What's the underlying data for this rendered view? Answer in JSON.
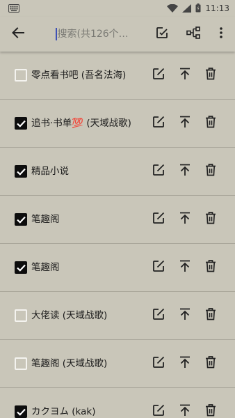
{
  "status_bar": {
    "time": "11:13",
    "icons": [
      "keyboard-icon",
      "wifi-icon",
      "signal-icon",
      "battery-icon"
    ]
  },
  "app_bar": {
    "icons": [
      "back-arrow-icon",
      "check-edit-icon",
      "tree-structure-icon",
      "more-vert-icon"
    ],
    "search": {
      "placeholder": "搜索(共126个…",
      "value": ""
    }
  },
  "row_icons": [
    "edit-icon",
    "move-top-icon",
    "delete-icon"
  ],
  "colors": {
    "background": "#c9c6b9",
    "divider": "#a9a69a",
    "checkbox_on": "#0d0d0d",
    "checkbox_off": "#f4f3ef"
  },
  "rows": [
    {
      "label": "零点看书吧 (吾名法海)",
      "checked": false
    },
    {
      "label": "追书·书单💯 (天域战歌)",
      "checked": true
    },
    {
      "label": "精品小说",
      "checked": true
    },
    {
      "label": "笔趣阁",
      "checked": true
    },
    {
      "label": "笔趣阁",
      "checked": true
    },
    {
      "label": "大佬读 (天域战歌)",
      "checked": false
    },
    {
      "label": "笔趣阁 (天域战歌)",
      "checked": false
    },
    {
      "label": "カクヨム (kak)",
      "checked": true
    }
  ]
}
